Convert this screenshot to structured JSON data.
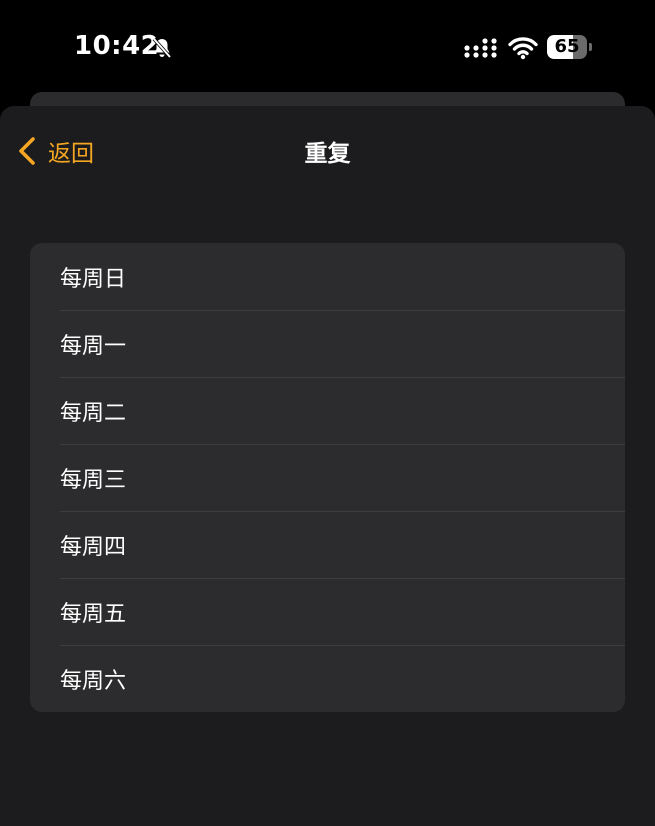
{
  "status_bar": {
    "time": "10:42",
    "battery_level": "65",
    "icons": [
      "bell-slash-icon",
      "signal-icon",
      "wifi-icon",
      "battery-icon"
    ]
  },
  "nav": {
    "back_label": "返回",
    "title": "重复"
  },
  "repeat_options": [
    {
      "label": "每周日"
    },
    {
      "label": "每周一"
    },
    {
      "label": "每周二"
    },
    {
      "label": "每周三"
    },
    {
      "label": "每周四"
    },
    {
      "label": "每周五"
    },
    {
      "label": "每周六"
    }
  ],
  "colors": {
    "accent": "#f5a623",
    "background": "#000000",
    "sheet": "#1c1c1e",
    "cell": "#2c2c2e",
    "separator": "#3d3d40"
  }
}
